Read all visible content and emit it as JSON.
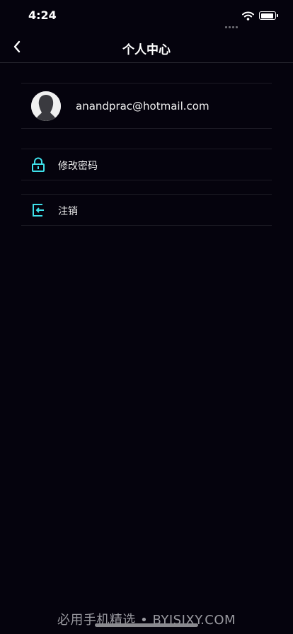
{
  "status_bar": {
    "time": "4:24",
    "icons": [
      "signal-icon",
      "wifi-icon",
      "battery-icon"
    ]
  },
  "nav": {
    "title": "个人中心",
    "back_icon": "chevron-left-icon"
  },
  "profile": {
    "avatar_icon": "avatar-silhouette",
    "email": "anandprac@hotmail.com"
  },
  "menu": {
    "items": [
      {
        "label": "修改密码",
        "icon": "lock-icon"
      },
      {
        "label": "注销",
        "icon": "logout-icon"
      }
    ]
  },
  "watermark": "必用手机精选 • BYJSJXY.COM",
  "colors": {
    "background": "#05030d",
    "accent": "#3ee0ea",
    "divider": "#1d1c25",
    "text": "#ffffff"
  }
}
